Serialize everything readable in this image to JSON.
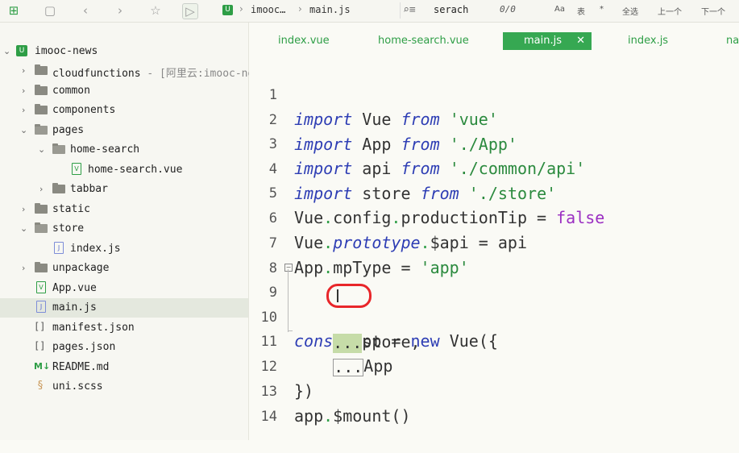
{
  "toolbar": {
    "icons": [
      "new-file-icon",
      "save-icon",
      "back-icon",
      "forward-icon",
      "star-icon",
      "run-icon"
    ],
    "breadcrumb": [
      "imooc…",
      "main.js"
    ],
    "search": {
      "value": "serach",
      "count": "0/0",
      "options": [
        "Aa",
        "表",
        "*",
        "全选",
        "上一个",
        "下一个"
      ]
    }
  },
  "sidebar": {
    "project": "imooc-news",
    "items": [
      {
        "label": "cloudfunctions",
        "extra": " - [阿里云:imooc-ne"
      },
      {
        "label": "common"
      },
      {
        "label": "components"
      },
      {
        "label": "pages"
      },
      {
        "label": "home-search"
      },
      {
        "label": "home-search.vue"
      },
      {
        "label": "tabbar"
      },
      {
        "label": "static"
      },
      {
        "label": "store"
      },
      {
        "label": "index.js"
      },
      {
        "label": "unpackage"
      },
      {
        "label": "App.vue"
      },
      {
        "label": "main.js"
      },
      {
        "label": "manifest.json"
      },
      {
        "label": "pages.json"
      },
      {
        "label": "README.md"
      },
      {
        "label": "uni.scss"
      }
    ]
  },
  "tabs": [
    "index.vue",
    "home-search.vue",
    "main.js",
    "index.js",
    "na"
  ],
  "editor": {
    "line_numbers": [
      "1",
      "2",
      "3",
      "4",
      "5",
      "6",
      "7",
      "8",
      "9",
      "10",
      "11",
      "12",
      "13",
      "14"
    ],
    "tokens": {
      "import": "import",
      "from": "from",
      "const": "const",
      "new": "new",
      "Vue": "Vue",
      "App": "App",
      "api": "api",
      "store": "store",
      "s_vue": "'vue'",
      "s_app": "'./App'",
      "s_api": "'./common/api'",
      "s_store": "'./store'",
      "config": "config",
      "productionTip": "productionTip",
      "eq": " = ",
      "false": "false",
      "prototype": "prototype",
      "dollar_api": "$api",
      "mpType": "mpType",
      "s_appstr": "'app'",
      "app": "app",
      "open": "({",
      "ellipsis": "...",
      "store_comma": "store,",
      "close": "})",
      "mount": "$mount()",
      "dot": "."
    }
  }
}
